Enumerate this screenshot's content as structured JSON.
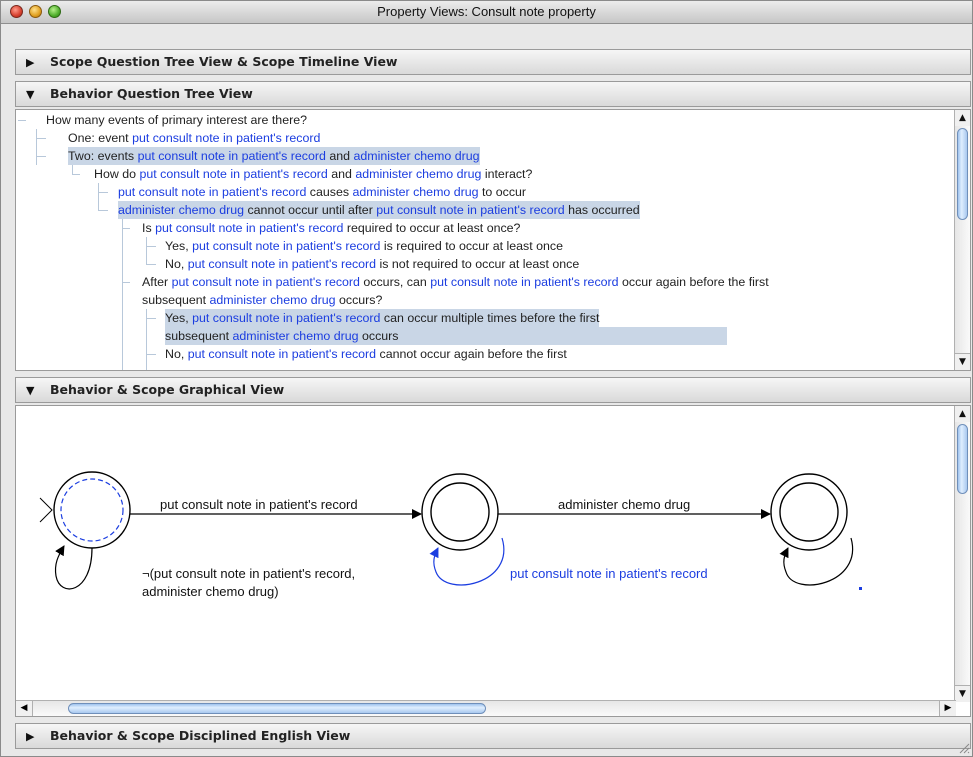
{
  "window": {
    "title": "Property Views: Consult note property"
  },
  "sections": {
    "scope_tree": {
      "label": "Scope Question Tree View & Scope Timeline View",
      "expanded": false
    },
    "behavior_tree": {
      "label": "Behavior Question Tree View",
      "expanded": true
    },
    "graphical": {
      "label": "Behavior & Scope Graphical View",
      "expanded": true
    },
    "english": {
      "label": "Behavior & Scope Disciplined English View",
      "expanded": false
    }
  },
  "tree": {
    "rows": [
      {
        "text": "How many events of primary interest are there?"
      },
      {
        "prefix": "One: event ",
        "e1": "put consult note in patient's record"
      },
      {
        "prefix": "Two: events ",
        "e1": "put consult note in patient's record",
        "mid": " and ",
        "e2": "administer chemo drug",
        "highlight": true
      },
      {
        "prefix": "How do ",
        "e1": "put consult note in patient's record",
        "mid": " and ",
        "e2": "administer chemo drug",
        "suffix": " interact?"
      },
      {
        "e1": "put consult note in patient's record",
        "mid": " causes ",
        "e2": "administer chemo drug",
        "suffix": " to occur"
      },
      {
        "e1": "administer chemo drug",
        "mid": " cannot occur until after ",
        "e2": "put consult note in patient's record",
        "suffix": " has occurred",
        "highlight": true
      },
      {
        "prefix": "Is ",
        "e1": "put consult note in patient's record",
        "suffix": " required to occur at least once?"
      },
      {
        "prefix": "Yes, ",
        "e1": "put consult note in patient's record",
        "suffix": " is required to occur at least once"
      },
      {
        "prefix": "No, ",
        "e1": "put consult note in patient's record",
        "suffix": " is not required to occur at least once"
      },
      {
        "prefix": "After ",
        "e1": "put consult note in patient's record",
        "mid": " occurs, can ",
        "e2": "put consult note in patient's record",
        "suffix": " occur again before the first"
      },
      {
        "prefix": "subsequent ",
        "e1": "administer chemo drug",
        "suffix": " occurs?"
      },
      {
        "prefix": "Yes, ",
        "e1": "put consult note in patient's record",
        "suffix": " can occur multiple times before the first",
        "highlight": true
      },
      {
        "prefix": "subsequent ",
        "e1": "administer chemo drug",
        "suffix": " occurs",
        "highlight": true
      },
      {
        "prefix": "No, ",
        "e1": "put consult note in patient's record",
        "suffix": " cannot occur again before the first"
      }
    ]
  },
  "graph": {
    "transition_1": "put consult note in patient's record",
    "transition_2": "administer chemo drug",
    "self_loop_1_line1": "¬(put consult note in patient's record,",
    "self_loop_1_line2": "administer chemo drug)",
    "self_loop_2": "put consult note in patient's record",
    "highlight_color": "#1b3de0"
  }
}
